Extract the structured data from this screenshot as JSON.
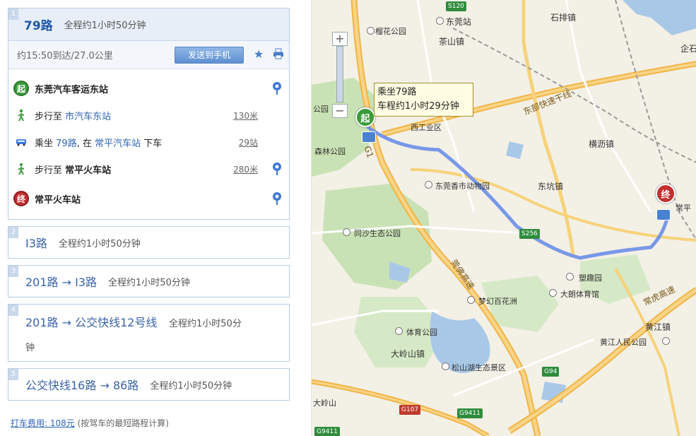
{
  "left_panel": {
    "route1": {
      "num": "1",
      "title": "79路",
      "total": "全程约1小时50分钟",
      "arrival": "约15:50到达/27.0公里",
      "send_label": "发送到手机",
      "steps": [
        {
          "icon": "起",
          "text": "东莞汽车客运东站"
        },
        {
          "prefix": "步行至",
          "link": "市汽车东站",
          "dist": "130米"
        },
        {
          "prefix": "乘坐",
          "link": "79路",
          "mid": ", 在",
          "link2": "常平汽车站",
          "suffix": "下车",
          "dist": "29站"
        },
        {
          "prefix": "步行至",
          "bold": "常平火车站",
          "dist": "280米"
        },
        {
          "icon": "终",
          "text": "常平火车站"
        }
      ]
    },
    "route2": {
      "num": "2",
      "title": "I3路",
      "total": "全程约1小时50分钟"
    },
    "route3": {
      "num": "3",
      "title": "201路 → I3路",
      "total": "全程约1小时50分钟"
    },
    "route4": {
      "num": "4",
      "title": "201路 → 公交快线12号线",
      "total": "全程约1小时50分",
      "total2": "钟"
    },
    "route5": {
      "num": "5",
      "title": "公交快线16路 → 86路",
      "total": "全程约1小时50分钟"
    },
    "taxi": {
      "label": "打车费用: 108元",
      "note": "(按驾车的最短路程计算)"
    }
  },
  "map": {
    "tooltip_line1": "乘坐79路",
    "tooltip_line2": "车程约1小时29分钟",
    "start_marker": "起",
    "end_marker": "终",
    "labels": {
      "shijie": "石排镇",
      "dongguanzhan": "东莞站",
      "chashan": "茶山镇",
      "liuhua": "榴花公园",
      "qishi": "企石",
      "gongyuan": "公园",
      "xigongye": "西工业区",
      "heping": "横沥镇",
      "senlin": "森林公园",
      "dongwuyuan": "东莞香市动物园",
      "dongkeng": "东坑镇",
      "changping": "常平",
      "shengtai": "同沙生态公园",
      "mengqu": "塑趣园",
      "dalang": "大朗体育馆",
      "menghuan": "梦幻百花洲",
      "tiyu": "体育公园",
      "huangjiang": "黄江镇",
      "huangjiang_park": "黄江人民公园",
      "daling": "大岭山镇",
      "songshanhu": "松山湖生态景区",
      "dalingshan": "大岭山"
    },
    "roads": {
      "s120": "S120",
      "g94": "G94",
      "g107": "G107",
      "g9411": "G9411",
      "g9411b": "G9411",
      "g1": "G1",
      "dongbu": "东部快速干线",
      "guanfo": "莞佛高速",
      "changhu": "常虎高速",
      "s256": "S256"
    }
  }
}
